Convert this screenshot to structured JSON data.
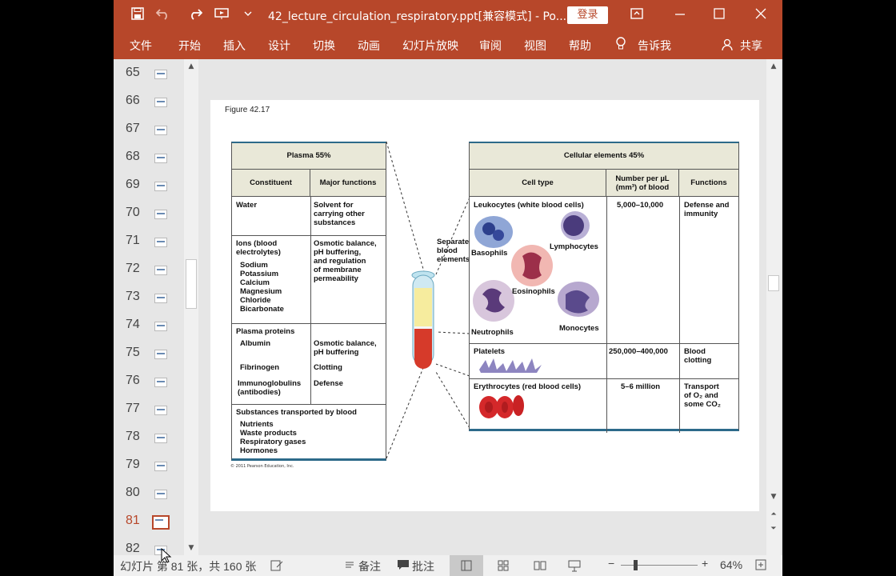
{
  "window": {
    "title": "42_lecture_circulation_respiratory.ppt[兼容模式] - Po...",
    "login": "登录"
  },
  "titlebar_icons": [
    "save-icon",
    "undo-icon",
    "redo-icon",
    "present-icon",
    "dropdown-icon",
    "restore-ribbon-icon",
    "minimize-icon",
    "maximize-icon",
    "close-icon"
  ],
  "ribbon": {
    "tabs": [
      "文件",
      "开始",
      "插入",
      "设计",
      "切换",
      "动画",
      "幻灯片放映",
      "审阅",
      "视图",
      "帮助"
    ],
    "tell": "告诉我",
    "share": "共享"
  },
  "thumbnails": [
    "65",
    "66",
    "67",
    "68",
    "69",
    "70",
    "71",
    "72",
    "73",
    "74",
    "75",
    "76",
    "77",
    "78",
    "79",
    "80",
    "81",
    "82"
  ],
  "selected_slide": "81",
  "slide": {
    "figure_label": "Figure 42.17",
    "plasma": {
      "title": "Plasma 55%",
      "col1": "Constituent",
      "col2": "Major functions",
      "water": "Water",
      "water_fn": "Solvent for\ncarrying other\nsubstances",
      "ions": "Ions (blood\nelectrolytes)",
      "ions_list": "Sodium\nPotassium\nCalcium\nMagnesium\nChloride\nBicarbonate",
      "ions_fn": "Osmotic balance,\npH buffering,\nand regulation\nof membrane\npermeability",
      "proteins": "Plasma proteins",
      "albumin": "Albumin",
      "albumin_fn": "Osmotic balance,\npH buffering",
      "fibrinogen": "Fibrinogen",
      "fibrinogen_fn": "Clotting",
      "immuno": "Immunoglobulins\n(antibodies)",
      "immuno_fn": "Defense",
      "transported": "Substances transported by blood",
      "transported_list": "Nutrients\nWaste products\nRespiratory gases\nHormones"
    },
    "tube_caption": "Separated\nblood\nelements",
    "cellular": {
      "title": "Cellular elements 45%",
      "col1": "Cell type",
      "col2": "Number per µL\n(mm³) of blood",
      "col3": "Functions",
      "leukocytes": "Leukocytes (white blood cells)",
      "leuko_num": "5,000–10,000",
      "leuko_fn": "Defense and\nimmunity",
      "basophils": "Basophils",
      "lymphocytes": "Lymphocytes",
      "eosinophils": "Eosinophils",
      "neutrophils": "Neutrophils",
      "monocytes": "Monocytes",
      "platelets": "Platelets",
      "platelets_num": "250,000–400,000",
      "platelets_fn": "Blood\nclotting",
      "erythrocytes": "Erythrocytes (red blood cells)",
      "ery_num": "5–6 million",
      "ery_fn": "Transport\nof O₂ and\nsome CO₂"
    },
    "copyright": "© 2011 Pearson Education, Inc."
  },
  "status": {
    "slide_info": "幻灯片 第 81 张，共 160 张",
    "notes": "备注",
    "comments": "批注",
    "zoom": "64%"
  }
}
